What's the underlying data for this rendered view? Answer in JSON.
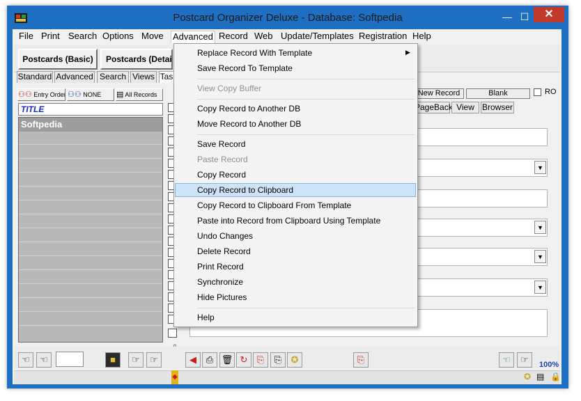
{
  "window": {
    "title": "Postcard Organizer Deluxe - Database: Softpedia",
    "minimize": "—",
    "maximize": "☐",
    "close": "✕"
  },
  "menubar": {
    "items": [
      "File",
      "Print",
      "Search",
      "Options",
      "Move",
      "Advanced",
      "Record",
      "Web",
      "Update/Templates",
      "Registration",
      "Help"
    ]
  },
  "toolbar": {
    "view_basic": "Postcards (Basic)",
    "view_detailed": "Postcards (Detaile"
  },
  "left_tabs": [
    "Standard",
    "Advanced",
    "Search",
    "Views",
    "Tas"
  ],
  "sort_buttons": {
    "entry_order": "Entry Order",
    "none": "NONE",
    "all_records": "All Records"
  },
  "list": {
    "header": "TITLE",
    "rows": [
      "Softpedia"
    ]
  },
  "right_panel": {
    "new_record": "New Record",
    "blank": "Blank",
    "ro": "RO",
    "tabs": [
      "PageBack",
      "View",
      "Browser"
    ],
    "zoom": "100%"
  },
  "context_menu": {
    "items": [
      {
        "label": "Replace Record With Template",
        "enabled": true,
        "submenu": true
      },
      {
        "label": "Save Record To Template",
        "enabled": true
      },
      {
        "label": "View Copy Buffer",
        "enabled": false
      },
      {
        "label": "Copy Record to Another DB",
        "enabled": true
      },
      {
        "label": "Move Record to Another DB",
        "enabled": true
      },
      {
        "label": "Save Record",
        "enabled": true
      },
      {
        "label": "Paste Record",
        "enabled": false
      },
      {
        "label": "Copy Record",
        "enabled": true
      },
      {
        "label": "Copy Record to Clipboard",
        "enabled": true,
        "highlighted": true
      },
      {
        "label": "Copy Record to Clipboard From Template",
        "enabled": true
      },
      {
        "label": "Paste into Record from Clipboard Using Template",
        "enabled": true
      },
      {
        "label": "Undo Changes",
        "enabled": true
      },
      {
        "label": "Delete Record",
        "enabled": true
      },
      {
        "label": "Print Record",
        "enabled": true
      },
      {
        "label": "Synchronize",
        "enabled": true
      },
      {
        "label": "Hide Pictures",
        "enabled": true
      },
      {
        "label": "Help",
        "enabled": true
      }
    ],
    "submenu_arrow": "▶"
  },
  "colors": {
    "frame": "#1e6fc1",
    "highlight": "#cde3f7",
    "title_text": "#1626c9"
  }
}
